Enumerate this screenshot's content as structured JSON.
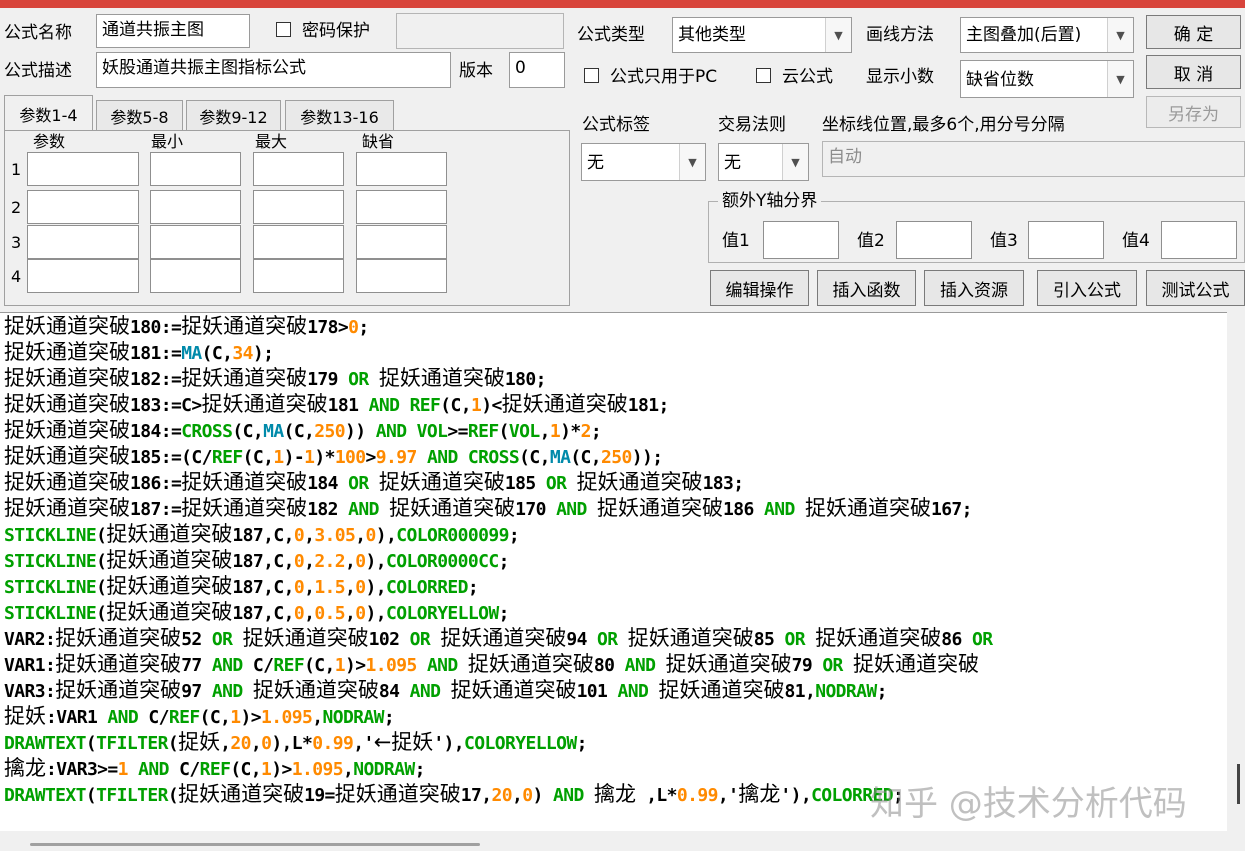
{
  "form": {
    "name_label": "公式名称",
    "name_value": "通道共振主图",
    "password_label": "密码保护",
    "password_value": "",
    "desc_label": "公式描述",
    "desc_value": "妖股通道共振主图指标公式",
    "version_label": "版本",
    "version_value": "0",
    "type_label": "公式类型",
    "type_value": "其他类型",
    "draw_label": "画线方法",
    "draw_value": "主图叠加(后置)",
    "pc_only_label": "公式只用于PC",
    "cloud_label": "云公式",
    "decimals_label": "显示小数",
    "decimals_value": "缺省位数",
    "tag_label": "公式标签",
    "tag_value": "无",
    "rule_label": "交易法则",
    "rule_value": "无",
    "axis_label": "坐标线位置,最多6个,用分号分隔",
    "axis_value": "自动",
    "yaxis_group_label": "额外Y轴分界",
    "v1_label": "值1",
    "v2_label": "值2",
    "v3_label": "值3",
    "v4_label": "值4"
  },
  "buttons": {
    "ok": "确  定",
    "cancel": "取  消",
    "save_as": "另存为",
    "edit_ops": "编辑操作",
    "insert_func": "插入函数",
    "insert_res": "插入资源",
    "import_formula": "引入公式",
    "test_formula": "测试公式"
  },
  "tabs": [
    "参数1-4",
    "参数5-8",
    "参数9-12",
    "参数13-16"
  ],
  "params": {
    "headers": [
      "参数",
      "最小",
      "最大",
      "缺省"
    ],
    "rows": [
      "1",
      "2",
      "3",
      "4"
    ]
  },
  "code_lines": [
    [
      [
        "t",
        "捉妖通道突破"
      ],
      [
        "t",
        "180:="
      ],
      [
        "t",
        "捉妖通道突破"
      ],
      [
        "t",
        "178>"
      ],
      [
        "n",
        "0"
      ],
      [
        "t",
        ";"
      ]
    ],
    [
      [
        "t",
        "捉妖通道突破"
      ],
      [
        "t",
        "181:="
      ],
      [
        "f",
        "MA"
      ],
      [
        "t",
        "(C,"
      ],
      [
        "n",
        "34"
      ],
      [
        "t",
        ");"
      ]
    ],
    [
      [
        "t",
        "捉妖通道突破"
      ],
      [
        "t",
        "182:="
      ],
      [
        "t",
        "捉妖通道突破"
      ],
      [
        "t",
        "179 "
      ],
      [
        "k",
        "OR"
      ],
      [
        "t",
        " "
      ],
      [
        "t",
        "捉妖通道突破"
      ],
      [
        "t",
        "180;"
      ]
    ],
    [
      [
        "t",
        "捉妖通道突破"
      ],
      [
        "t",
        "183:=C>"
      ],
      [
        "t",
        "捉妖通道突破"
      ],
      [
        "t",
        "181 "
      ],
      [
        "k",
        "AND REF"
      ],
      [
        "t",
        "(C,"
      ],
      [
        "n",
        "1"
      ],
      [
        "t",
        ")<"
      ],
      [
        "t",
        "捉妖通道突破"
      ],
      [
        "t",
        "181;"
      ]
    ],
    [
      [
        "t",
        "捉妖通道突破"
      ],
      [
        "t",
        "184:="
      ],
      [
        "k",
        "CROSS"
      ],
      [
        "t",
        "(C,"
      ],
      [
        "f",
        "MA"
      ],
      [
        "t",
        "(C,"
      ],
      [
        "n",
        "250"
      ],
      [
        "t",
        ")) "
      ],
      [
        "k",
        "AND VOL"
      ],
      [
        "t",
        ">="
      ],
      [
        "k",
        "REF"
      ],
      [
        "t",
        "("
      ],
      [
        "k",
        "VOL"
      ],
      [
        "t",
        ","
      ],
      [
        "n",
        "1"
      ],
      [
        "t",
        ")*"
      ],
      [
        "n",
        "2"
      ],
      [
        "t",
        ";"
      ]
    ],
    [
      [
        "t",
        "捉妖通道突破"
      ],
      [
        "t",
        "185:=(C/"
      ],
      [
        "k",
        "REF"
      ],
      [
        "t",
        "(C,"
      ],
      [
        "n",
        "1"
      ],
      [
        "t",
        ")-"
      ],
      [
        "n",
        "1"
      ],
      [
        "t",
        ")*"
      ],
      [
        "n",
        "100"
      ],
      [
        "t",
        ">"
      ],
      [
        "n",
        "9.97 "
      ],
      [
        "k",
        "AND CROSS"
      ],
      [
        "t",
        "(C,"
      ],
      [
        "f",
        "MA"
      ],
      [
        "t",
        "(C,"
      ],
      [
        "n",
        "250"
      ],
      [
        "t",
        "));"
      ]
    ],
    [
      [
        "t",
        "捉妖通道突破"
      ],
      [
        "t",
        "186:="
      ],
      [
        "t",
        "捉妖通道突破"
      ],
      [
        "t",
        "184 "
      ],
      [
        "k",
        "OR"
      ],
      [
        "t",
        " "
      ],
      [
        "t",
        "捉妖通道突破"
      ],
      [
        "t",
        "185 "
      ],
      [
        "k",
        "OR"
      ],
      [
        "t",
        " "
      ],
      [
        "t",
        "捉妖通道突破"
      ],
      [
        "t",
        "183;"
      ]
    ],
    [
      [
        "t",
        "捉妖通道突破"
      ],
      [
        "t",
        "187:="
      ],
      [
        "t",
        "捉妖通道突破"
      ],
      [
        "t",
        "182 "
      ],
      [
        "k",
        "AND"
      ],
      [
        "t",
        " "
      ],
      [
        "t",
        "捉妖通道突破"
      ],
      [
        "t",
        "170 "
      ],
      [
        "k",
        "AND"
      ],
      [
        "t",
        " "
      ],
      [
        "t",
        "捉妖通道突破"
      ],
      [
        "t",
        "186 "
      ],
      [
        "k",
        "AND"
      ],
      [
        "t",
        " "
      ],
      [
        "t",
        "捉妖通道突破"
      ],
      [
        "t",
        "167;"
      ]
    ],
    [
      [
        "k",
        "STICKLINE"
      ],
      [
        "t",
        "("
      ],
      [
        "t",
        "捉妖通道突破"
      ],
      [
        "t",
        "187,C,"
      ],
      [
        "n",
        "0"
      ],
      [
        "t",
        ","
      ],
      [
        "n",
        "3.05"
      ],
      [
        "t",
        ","
      ],
      [
        "n",
        "0"
      ],
      [
        "t",
        "),"
      ],
      [
        "k",
        "COLOR000099"
      ],
      [
        "t",
        ";"
      ]
    ],
    [
      [
        "k",
        "STICKLINE"
      ],
      [
        "t",
        "("
      ],
      [
        "t",
        "捉妖通道突破"
      ],
      [
        "t",
        "187,C,"
      ],
      [
        "n",
        "0"
      ],
      [
        "t",
        ","
      ],
      [
        "n",
        "2.2"
      ],
      [
        "t",
        ","
      ],
      [
        "n",
        "0"
      ],
      [
        "t",
        "),"
      ],
      [
        "k",
        "COLOR0000CC"
      ],
      [
        "t",
        ";"
      ]
    ],
    [
      [
        "k",
        "STICKLINE"
      ],
      [
        "t",
        "("
      ],
      [
        "t",
        "捉妖通道突破"
      ],
      [
        "t",
        "187,C,"
      ],
      [
        "n",
        "0"
      ],
      [
        "t",
        ","
      ],
      [
        "n",
        "1.5"
      ],
      [
        "t",
        ","
      ],
      [
        "n",
        "0"
      ],
      [
        "t",
        "),"
      ],
      [
        "k",
        "COLORRED"
      ],
      [
        "t",
        ";"
      ]
    ],
    [
      [
        "k",
        "STICKLINE"
      ],
      [
        "t",
        "("
      ],
      [
        "t",
        "捉妖通道突破"
      ],
      [
        "t",
        "187,C,"
      ],
      [
        "n",
        "0"
      ],
      [
        "t",
        ","
      ],
      [
        "n",
        "0.5"
      ],
      [
        "t",
        ","
      ],
      [
        "n",
        "0"
      ],
      [
        "t",
        "),"
      ],
      [
        "k",
        "COLORYELLOW"
      ],
      [
        "t",
        ";"
      ]
    ],
    [
      [
        "t",
        "VAR2:"
      ],
      [
        "t",
        "捉妖通道突破"
      ],
      [
        "t",
        "52 "
      ],
      [
        "k",
        "OR"
      ],
      [
        "t",
        " "
      ],
      [
        "t",
        "捉妖通道突破"
      ],
      [
        "t",
        "102 "
      ],
      [
        "k",
        "OR"
      ],
      [
        "t",
        " "
      ],
      [
        "t",
        "捉妖通道突破"
      ],
      [
        "t",
        "94 "
      ],
      [
        "k",
        "OR"
      ],
      [
        "t",
        " "
      ],
      [
        "t",
        "捉妖通道突破"
      ],
      [
        "t",
        "85 "
      ],
      [
        "k",
        "OR"
      ],
      [
        "t",
        " "
      ],
      [
        "t",
        "捉妖通道突破"
      ],
      [
        "t",
        "86 "
      ],
      [
        "k",
        "OR"
      ]
    ],
    [
      [
        "t",
        "VAR1:"
      ],
      [
        "t",
        "捉妖通道突破"
      ],
      [
        "t",
        "77 "
      ],
      [
        "k",
        "AND"
      ],
      [
        "t",
        " C/"
      ],
      [
        "k",
        "REF"
      ],
      [
        "t",
        "(C,"
      ],
      [
        "n",
        "1"
      ],
      [
        "t",
        ")>"
      ],
      [
        "n",
        "1.095 "
      ],
      [
        "k",
        "AND"
      ],
      [
        "t",
        " "
      ],
      [
        "t",
        "捉妖通道突破"
      ],
      [
        "t",
        "80 "
      ],
      [
        "k",
        "AND"
      ],
      [
        "t",
        " "
      ],
      [
        "t",
        "捉妖通道突破"
      ],
      [
        "t",
        "79 "
      ],
      [
        "k",
        "OR"
      ],
      [
        "t",
        " "
      ],
      [
        "t",
        "捉妖通道突破"
      ]
    ],
    [
      [
        "t",
        "VAR3:"
      ],
      [
        "t",
        "捉妖通道突破"
      ],
      [
        "t",
        "97 "
      ],
      [
        "k",
        "AND"
      ],
      [
        "t",
        " "
      ],
      [
        "t",
        "捉妖通道突破"
      ],
      [
        "t",
        "84 "
      ],
      [
        "k",
        "AND"
      ],
      [
        "t",
        " "
      ],
      [
        "t",
        "捉妖通道突破"
      ],
      [
        "t",
        "101 "
      ],
      [
        "k",
        "AND"
      ],
      [
        "t",
        " "
      ],
      [
        "t",
        "捉妖通道突破"
      ],
      [
        "t",
        "81,"
      ],
      [
        "k",
        "NODRAW"
      ],
      [
        "t",
        ";"
      ]
    ],
    [
      [
        "t",
        "捉妖"
      ],
      [
        "t",
        ":VAR1 "
      ],
      [
        "k",
        "AND"
      ],
      [
        "t",
        " C/"
      ],
      [
        "k",
        "REF"
      ],
      [
        "t",
        "(C,"
      ],
      [
        "n",
        "1"
      ],
      [
        "t",
        ")>"
      ],
      [
        "n",
        "1.095"
      ],
      [
        "t",
        ","
      ],
      [
        "k",
        "NODRAW"
      ],
      [
        "t",
        ";"
      ]
    ],
    [
      [
        "k",
        "DRAWTEXT"
      ],
      [
        "t",
        "("
      ],
      [
        "k",
        "TFILTER"
      ],
      [
        "t",
        "("
      ],
      [
        "t",
        "捉妖"
      ],
      [
        "t",
        ","
      ],
      [
        "n",
        "20"
      ],
      [
        "t",
        ","
      ],
      [
        "n",
        "0"
      ],
      [
        "t",
        "),L*"
      ],
      [
        "n",
        "0.99"
      ],
      [
        "t",
        ",'"
      ],
      [
        "t",
        "←捉妖"
      ],
      [
        "t",
        "'),"
      ],
      [
        "k",
        "COLORYELLOW"
      ],
      [
        "t",
        ";"
      ]
    ],
    [
      [
        "t",
        "擒龙"
      ],
      [
        "t",
        ":VAR3>="
      ],
      [
        "n",
        "1 "
      ],
      [
        "k",
        "AND"
      ],
      [
        "t",
        " C/"
      ],
      [
        "k",
        "REF"
      ],
      [
        "t",
        "(C,"
      ],
      [
        "n",
        "1"
      ],
      [
        "t",
        ")>"
      ],
      [
        "n",
        "1.095"
      ],
      [
        "t",
        ","
      ],
      [
        "k",
        "NODRAW"
      ],
      [
        "t",
        ";"
      ]
    ],
    [
      [
        "k",
        "DRAWTEXT"
      ],
      [
        "t",
        "("
      ],
      [
        "k",
        "TFILTER"
      ],
      [
        "t",
        "("
      ],
      [
        "t",
        "捉妖通道突破"
      ],
      [
        "t",
        "19="
      ],
      [
        "t",
        "捉妖通道突破"
      ],
      [
        "t",
        "17,"
      ],
      [
        "n",
        "20"
      ],
      [
        "t",
        ","
      ],
      [
        "n",
        "0"
      ],
      [
        "t",
        ") "
      ],
      [
        "k",
        "AND"
      ],
      [
        "t",
        " "
      ],
      [
        "t",
        "擒龙"
      ],
      [
        "t",
        " ,L*"
      ],
      [
        "n",
        "0.99"
      ],
      [
        "t",
        ",'"
      ],
      [
        "t",
        "擒龙"
      ],
      [
        "t",
        "'),"
      ],
      [
        "k",
        "COLORRED"
      ],
      [
        "t",
        ";"
      ]
    ]
  ],
  "watermark": "知乎 @技术分析代码",
  "colors": {
    "keyword": "#00a000",
    "function": "#008aaa",
    "number": "#ff8a00",
    "accent_bar": "#d8443b"
  }
}
